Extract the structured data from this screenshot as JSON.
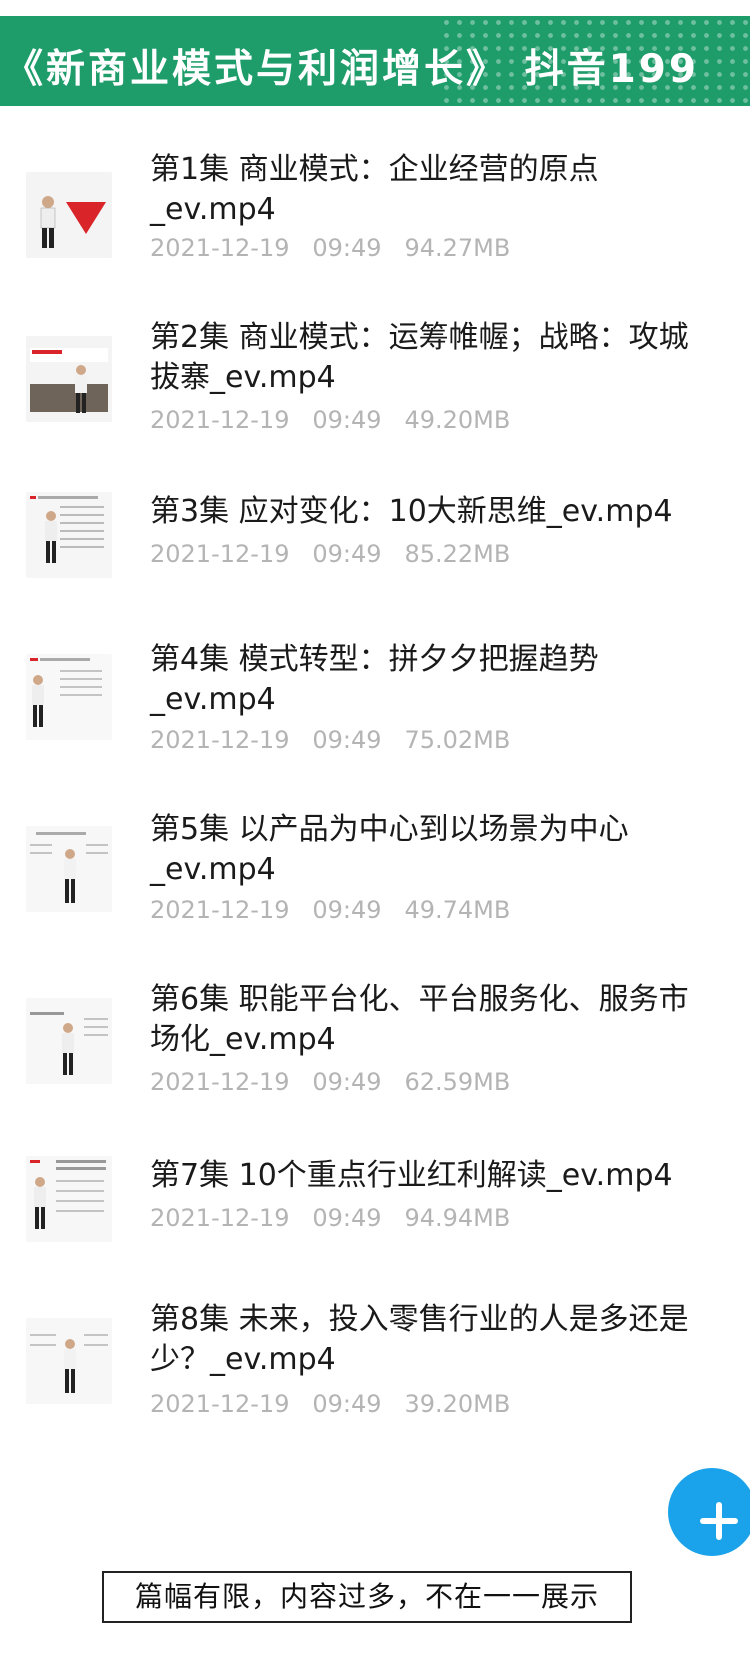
{
  "banner": {
    "title": "《新商业模式与利润增长》 抖音199"
  },
  "files": [
    {
      "name": "第1集 商业模式：企业经营的原点_ev.mp4",
      "date": "2021-12-19",
      "time": "09:49",
      "size": "94.27MB"
    },
    {
      "name": "第2集 商业模式：运筹帷幄；战略：攻城拔寨_ev.mp4",
      "date": "2021-12-19",
      "time": "09:49",
      "size": "49.20MB"
    },
    {
      "name": "第3集 应对变化：10大新思维_ev.mp4",
      "date": "2021-12-19",
      "time": "09:49",
      "size": "85.22MB"
    },
    {
      "name": "第4集 模式转型：拼夕夕把握趋势_ev.mp4",
      "date": "2021-12-19",
      "time": "09:49",
      "size": "75.02MB"
    },
    {
      "name": "第5集 以产品为中心到以场景为中心_ev.mp4",
      "date": "2021-12-19",
      "time": "09:49",
      "size": "49.74MB"
    },
    {
      "name": "第6集 职能平台化、平台服务化、服务市场化_ev.mp4",
      "date": "2021-12-19",
      "time": "09:49",
      "size": "62.59MB"
    },
    {
      "name": "第7集 10个重点行业红利解读_ev.mp4",
      "date": "2021-12-19",
      "time": "09:49",
      "size": "94.94MB"
    },
    {
      "name": "第8集 未来，投入零售行业的人是多还是少？_ev.mp4",
      "date": "2021-12-19",
      "time": "09:49",
      "size": "39.20MB"
    }
  ],
  "fab": {
    "icon": "plus-icon",
    "color": "#1aa3ea"
  },
  "footer": {
    "note": "篇幅有限，内容过多，不在一一展示"
  },
  "colors": {
    "banner": "#1e9d6b",
    "meta_text": "#b4b4b4",
    "accent_red": "#d9252a"
  }
}
